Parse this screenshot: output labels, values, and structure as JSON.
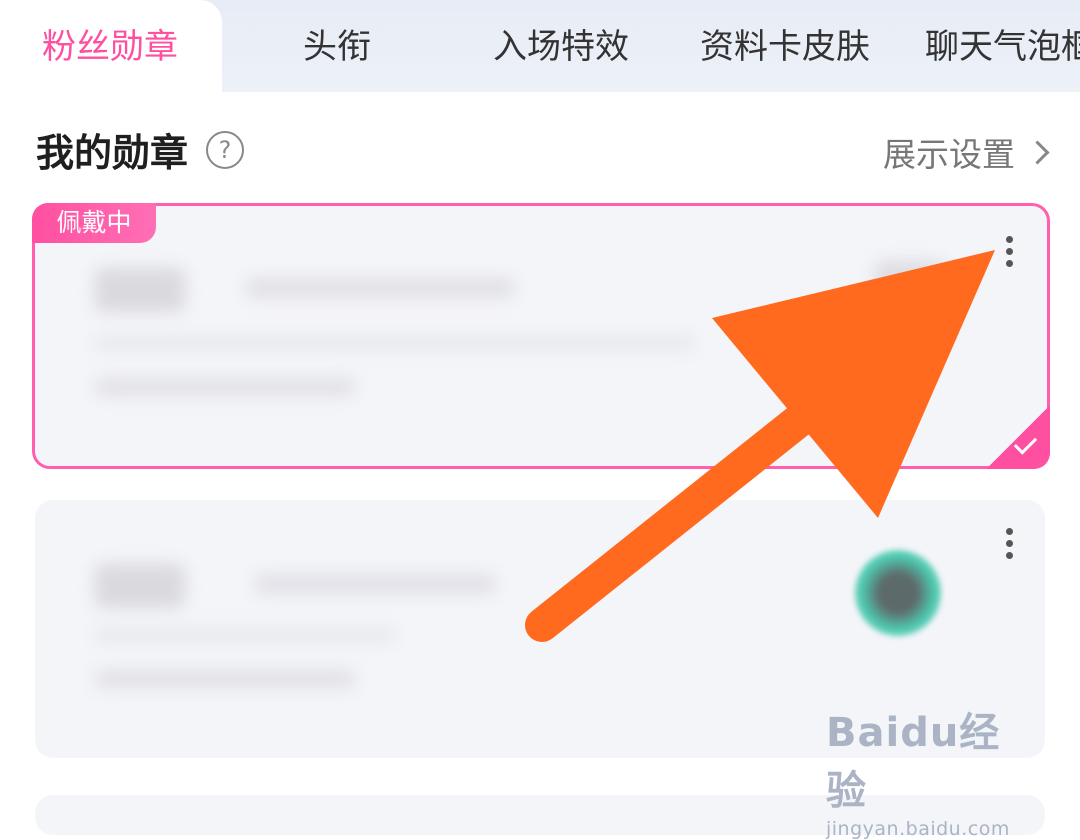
{
  "tabs": [
    {
      "label": "粉丝勋章",
      "active": true
    },
    {
      "label": "头衔",
      "active": false
    },
    {
      "label": "入场特效",
      "active": false
    },
    {
      "label": "资料卡皮肤",
      "active": false
    },
    {
      "label": "聊天气泡框",
      "active": false
    }
  ],
  "section": {
    "title": "我的勋章",
    "help_icon": "question-circle-icon",
    "settings_label": "展示设置"
  },
  "cards": [
    {
      "badge": "佩戴中",
      "selected": true
    },
    {
      "selected": false
    }
  ],
  "watermark": {
    "brand": "Baidu经验",
    "url": "jingyan.baidu.com"
  },
  "colors": {
    "accent": "#ff4fa1",
    "annotation_arrow": "#ff6a1f"
  }
}
